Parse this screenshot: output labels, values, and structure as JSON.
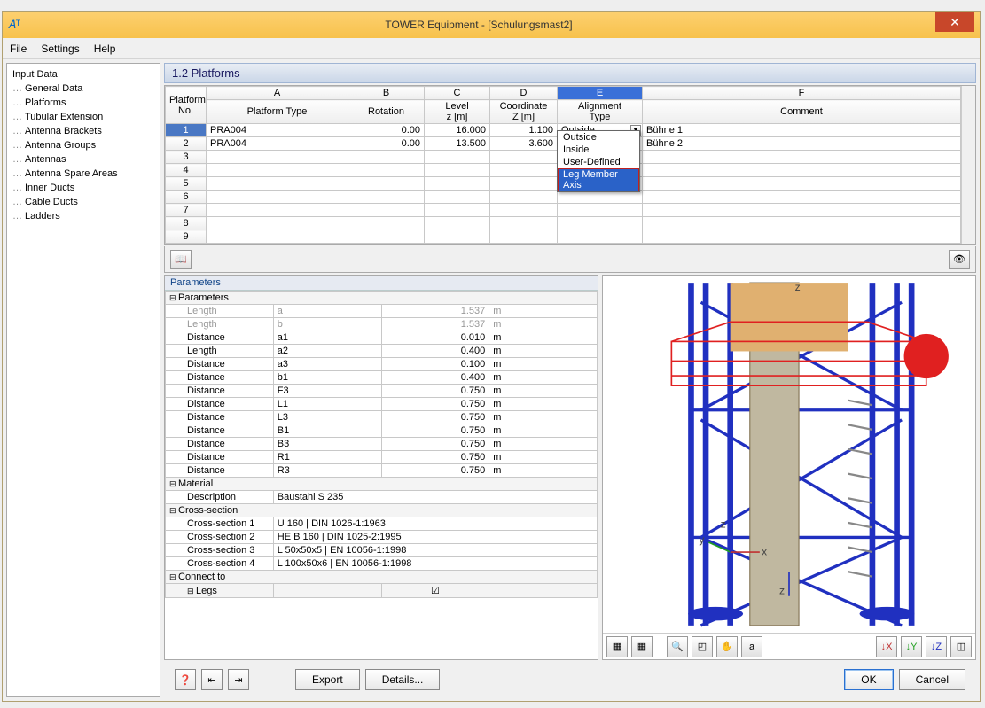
{
  "window": {
    "title": "TOWER Equipment - [Schulungsmast2]"
  },
  "menu": [
    "File",
    "Settings",
    "Help"
  ],
  "tree": {
    "root": "Input Data",
    "nodes": [
      "General Data",
      "Platforms",
      "Tubular Extension",
      "Antenna Brackets",
      "Antenna Groups",
      "Antennas",
      "Antenna Spare Areas",
      "Inner Ducts",
      "Cable Ducts",
      "Ladders"
    ]
  },
  "heading": "1.2 Platforms",
  "grid": {
    "letters": [
      "A",
      "B",
      "C",
      "D",
      "E",
      "F"
    ],
    "headers_no": "Platform\nNo.",
    "headers": [
      "Platform Type",
      "Rotation",
      "Level\nz [m]",
      "Coordinate\nZ [m]",
      "Alignment\nType",
      "Comment"
    ],
    "rows": [
      {
        "no": "1",
        "type": "PRA004",
        "rot": "0.00",
        "level": "16.000",
        "z": "1.100",
        "align": "Outside",
        "comment": "Bühne 1"
      },
      {
        "no": "2",
        "type": "PRA004",
        "rot": "0.00",
        "level": "13.500",
        "z": "3.600",
        "align": "",
        "comment": "Bühne 2"
      },
      {
        "no": "3"
      },
      {
        "no": "4"
      },
      {
        "no": "5"
      },
      {
        "no": "6"
      },
      {
        "no": "7"
      },
      {
        "no": "8"
      },
      {
        "no": "9"
      }
    ],
    "dropdown": {
      "options": [
        "Outside",
        "Inside",
        "User-Defined",
        "Leg Member Axis"
      ],
      "selected": "Leg Member Axis"
    }
  },
  "params": {
    "title": "Parameters",
    "groups": [
      {
        "name": "Parameters",
        "rows": [
          {
            "k": "Length",
            "v1": "a",
            "v2": "1.537",
            "u": "m",
            "dim": true
          },
          {
            "k": "Length",
            "v1": "b",
            "v2": "1.537",
            "u": "m",
            "dim": true
          },
          {
            "k": "Distance",
            "v1": "a1",
            "v2": "0.010",
            "u": "m"
          },
          {
            "k": "Length",
            "v1": "a2",
            "v2": "0.400",
            "u": "m"
          },
          {
            "k": "Distance",
            "v1": "a3",
            "v2": "0.100",
            "u": "m"
          },
          {
            "k": "Distance",
            "v1": "b1",
            "v2": "0.400",
            "u": "m"
          },
          {
            "k": "Distance",
            "v1": "F3",
            "v2": "0.750",
            "u": "m"
          },
          {
            "k": "Distance",
            "v1": "L1",
            "v2": "0.750",
            "u": "m"
          },
          {
            "k": "Distance",
            "v1": "L3",
            "v2": "0.750",
            "u": "m"
          },
          {
            "k": "Distance",
            "v1": "B1",
            "v2": "0.750",
            "u": "m"
          },
          {
            "k": "Distance",
            "v1": "B3",
            "v2": "0.750",
            "u": "m"
          },
          {
            "k": "Distance",
            "v1": "R1",
            "v2": "0.750",
            "u": "m"
          },
          {
            "k": "Distance",
            "v1": "R3",
            "v2": "0.750",
            "u": "m"
          }
        ]
      },
      {
        "name": "Material",
        "rows": [
          {
            "k": "Description",
            "v2": "Baustahl S 235",
            "span": true
          }
        ]
      },
      {
        "name": "Cross-section",
        "rows": [
          {
            "k": "Cross-section 1",
            "v2": "U 160 | DIN 1026-1:1963",
            "span": true
          },
          {
            "k": "Cross-section 2",
            "v2": "HE B 160 | DIN 1025-2:1995",
            "span": true
          },
          {
            "k": "Cross-section 3",
            "v2": "L 50x50x5 | EN 10056-1:1998",
            "span": true
          },
          {
            "k": "Cross-section 4",
            "v2": "L 100x50x6 | EN 10056-1:1998",
            "span": true
          }
        ]
      },
      {
        "name": "Connect to",
        "rows": [
          {
            "k": "Legs",
            "cb": true,
            "sub": true
          }
        ]
      }
    ]
  },
  "preview_toolbar": [
    "page1",
    "page2",
    "zoom",
    "rect",
    "hand",
    "dim",
    "",
    "x",
    "y",
    "z",
    "iso"
  ],
  "footer": {
    "export": "Export",
    "details": "Details...",
    "ok": "OK",
    "cancel": "Cancel"
  }
}
